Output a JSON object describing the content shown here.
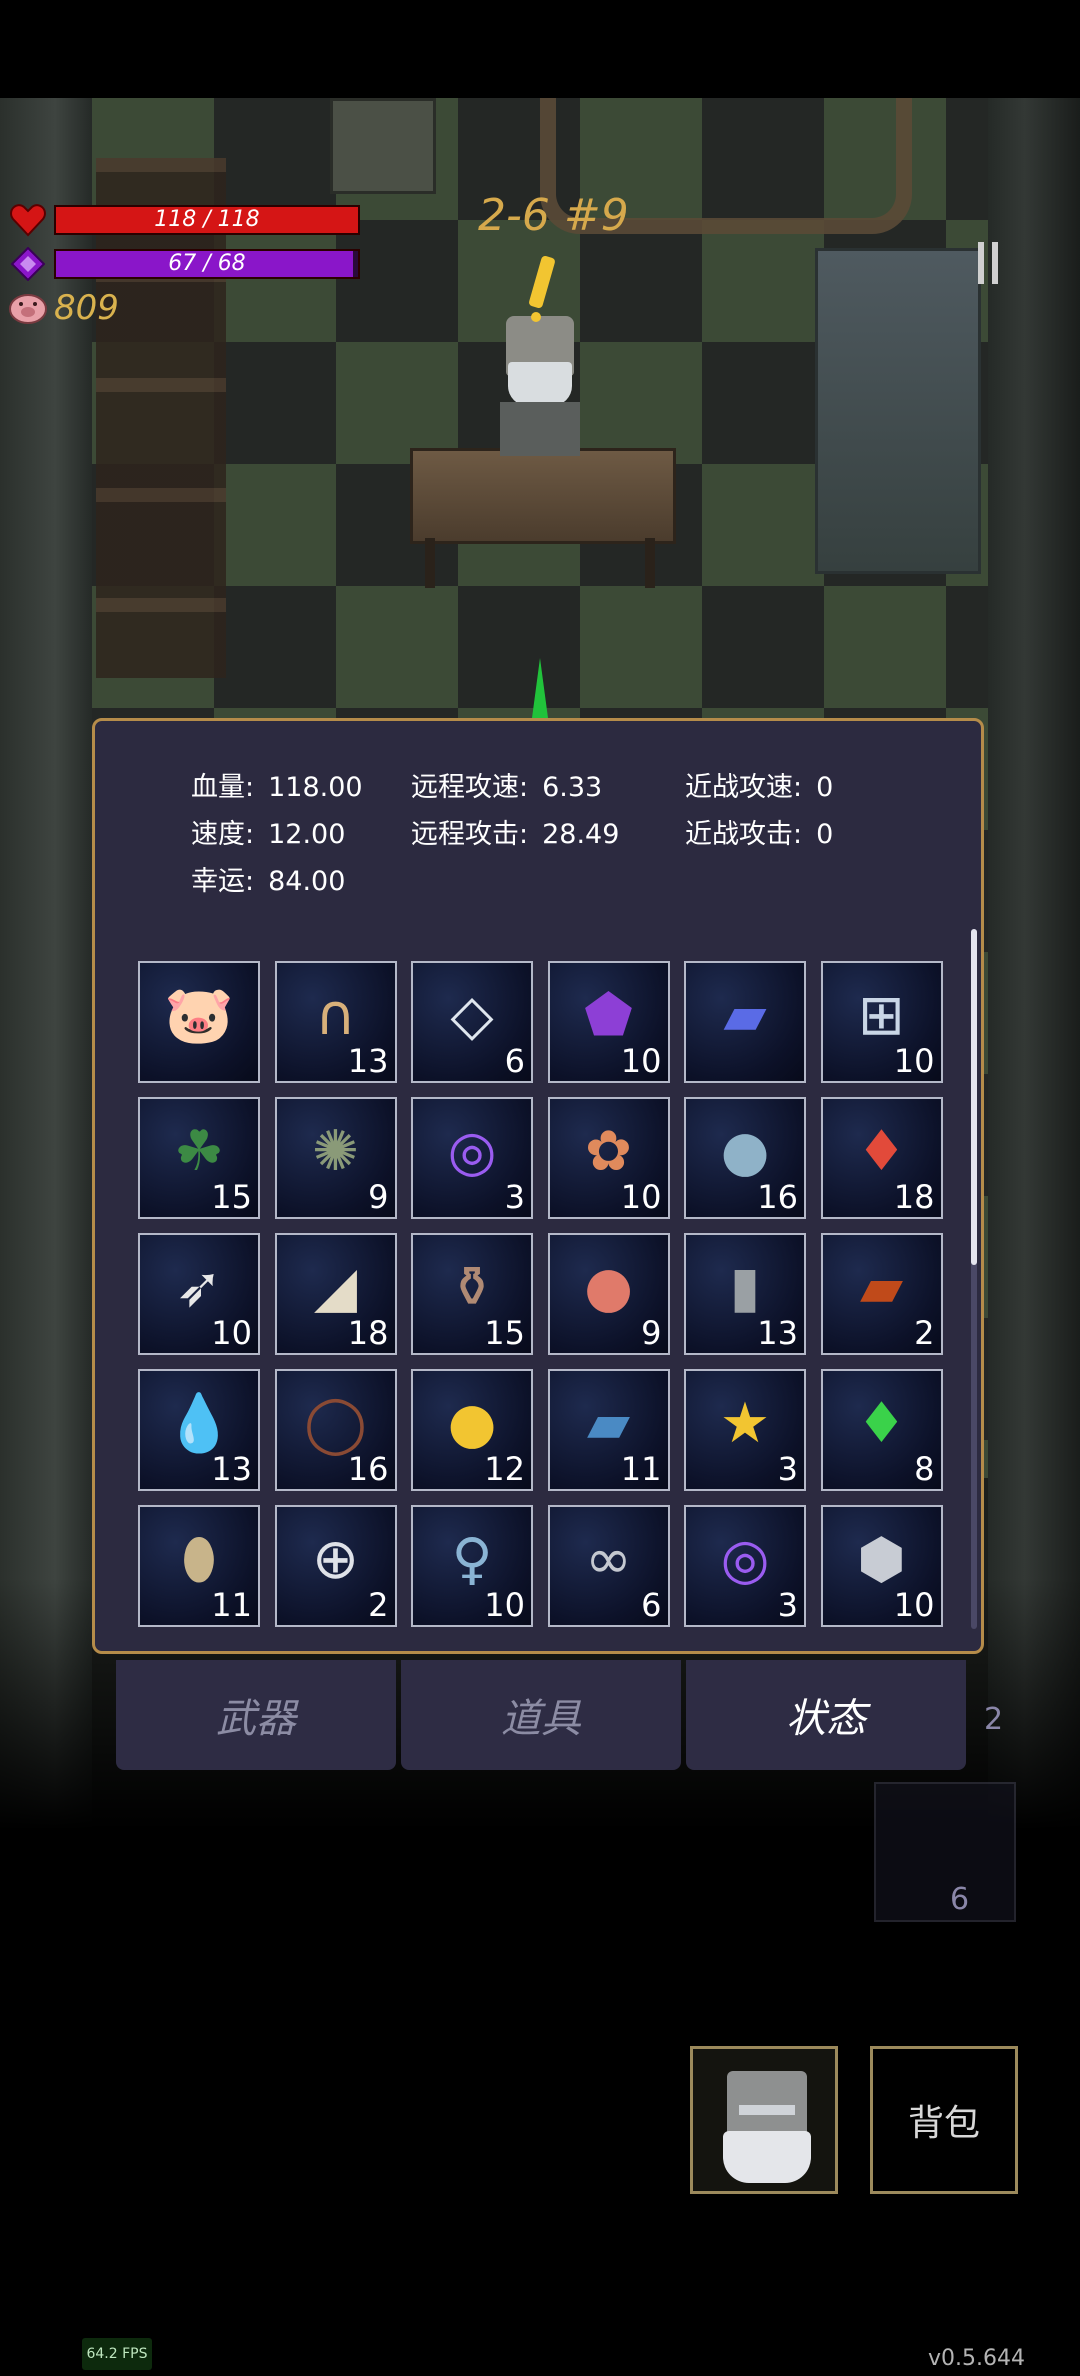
{
  "hud": {
    "hp_text": "118 / 118",
    "hp_fill": 1.0,
    "mana_text": "67 / 68",
    "mana_fill": 0.985,
    "coins": "809",
    "stage": "2-6 #9",
    "colors": {
      "hp": "#d51515",
      "mana": "#8a16c9",
      "coin": "#d9b24e",
      "stage": "#d6a94c"
    },
    "icons": {
      "hp": "heart-icon",
      "mana": "diamond-icon",
      "coin": "pig-icon",
      "pause": "pause-icon"
    }
  },
  "stats": {
    "hp": {
      "label": "血量:",
      "value": "118.00"
    },
    "ranged_speed": {
      "label": "远程攻速:",
      "value": "6.33"
    },
    "melee_speed": {
      "label": "近战攻速:",
      "value": "0"
    },
    "speed": {
      "label": "速度:",
      "value": "12.00"
    },
    "ranged_attack": {
      "label": "远程攻击:",
      "value": "28.49"
    },
    "melee_attack": {
      "label": "近战攻击:",
      "value": "0"
    },
    "luck": {
      "label": "幸运:",
      "value": "84.00"
    }
  },
  "inventory": [
    {
      "icon": "piggy-bank-icon",
      "glyph": "🐷",
      "count": ""
    },
    {
      "icon": "horseshoe-icon",
      "glyph": "∩",
      "count": "13"
    },
    {
      "icon": "diamond-chevron-icon",
      "glyph": "◇",
      "count": "6"
    },
    {
      "icon": "purple-crystal-icon",
      "glyph": "⬟",
      "count": "10"
    },
    {
      "icon": "spellbook-icon",
      "glyph": "▰",
      "count": ""
    },
    {
      "icon": "medkit-icon",
      "glyph": "⊞",
      "count": "10"
    },
    {
      "icon": "four-leaf-clover-icon",
      "glyph": "☘",
      "count": "15"
    },
    {
      "icon": "octopus-icon",
      "glyph": "✺",
      "count": "9"
    },
    {
      "icon": "vortex-rune-icon",
      "glyph": "◎",
      "count": "3"
    },
    {
      "icon": "flower-bouquet-icon",
      "glyph": "✿",
      "count": "10"
    },
    {
      "icon": "stone-icon",
      "glyph": "●",
      "count": "16"
    },
    {
      "icon": "red-crystal-icon",
      "glyph": "♦",
      "count": "18"
    },
    {
      "icon": "feather-icon",
      "glyph": "➶",
      "count": "10"
    },
    {
      "icon": "horn-icon",
      "glyph": "◢",
      "count": "18"
    },
    {
      "icon": "vase-icon",
      "glyph": "⚱",
      "count": "15"
    },
    {
      "icon": "apple-icon",
      "glyph": "●",
      "count": "9"
    },
    {
      "icon": "tombstone-icon",
      "glyph": "▮",
      "count": "13"
    },
    {
      "icon": "red-tome-icon",
      "glyph": "▰",
      "count": "2"
    },
    {
      "icon": "water-drop-icon",
      "glyph": "💧",
      "count": "13"
    },
    {
      "icon": "thorn-wreath-icon",
      "glyph": "◯",
      "count": "16"
    },
    {
      "icon": "gold-coin-icon",
      "glyph": "●",
      "count": "12"
    },
    {
      "icon": "blue-book-icon",
      "glyph": "▰",
      "count": "11"
    },
    {
      "icon": "star-trophy-icon",
      "glyph": "★",
      "count": "3"
    },
    {
      "icon": "green-crystal-icon",
      "glyph": "♦",
      "count": "8"
    },
    {
      "icon": "egg-icon",
      "glyph": "⬮",
      "count": "11"
    },
    {
      "icon": "ring-icon",
      "glyph": "⊕",
      "count": "2"
    },
    {
      "icon": "hand-mirror-icon",
      "glyph": "♀",
      "count": "10"
    },
    {
      "icon": "rings-icon",
      "glyph": "∞",
      "count": "6"
    },
    {
      "icon": "vortex-rune-icon",
      "glyph": "◎",
      "count": "3"
    },
    {
      "icon": "silver-ore-icon",
      "glyph": "⬢",
      "count": "10"
    }
  ],
  "tabs": {
    "weapons": "武器",
    "items": "道具",
    "status": "状态",
    "active": "status"
  },
  "side_counts": {
    "a": "2",
    "b": "6"
  },
  "buttons": {
    "bag": "背包",
    "portrait": "portrait-icon"
  },
  "fps": "64.2 FPS",
  "version": "v0.5.644"
}
